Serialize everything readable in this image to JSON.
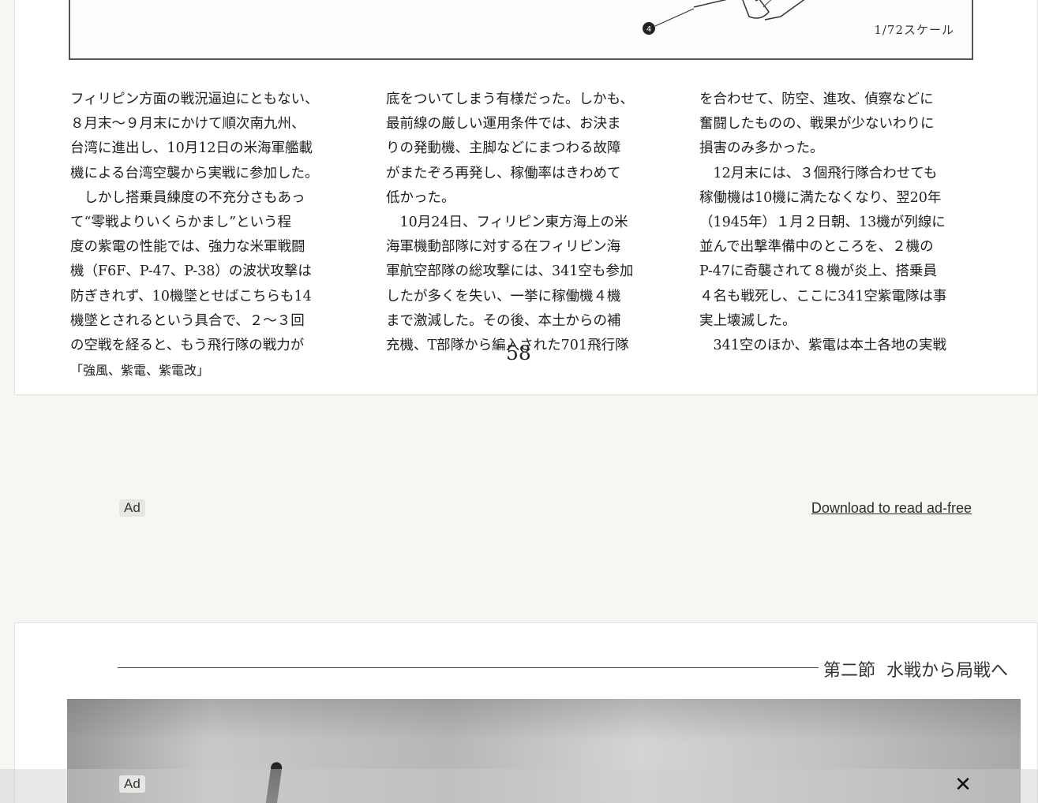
{
  "page_top": {
    "figure_scale_label": "1/72スケール",
    "figure_callout": "4",
    "columns": [
      [
        "フィリピン方面の戦況逼迫にともない、",
        "８月末～９月末にかけて順次南九州、",
        "台湾に進出し、10月12日の米海軍艦載",
        "機による台湾空襲から実戦に参加した。",
        "　しかし搭乗員練度の不充分さもあっ",
        "て“零戦よりいくらかまし”という程",
        "度の紫電の性能では、強力な米軍戦闘",
        "機（F6F、P-47、P-38）の波状攻撃は",
        "防ぎきれず、10機墜とせばこちらも14",
        "機墜とされるという具合で、２～３回",
        "の空戦を経ると、もう飛行隊の戦力が",
        "「強風、紫電、紫電改」"
      ],
      [
        "底をついてしまう有様だった。しかも、",
        "最前線の厳しい運用条件では、お決ま",
        "りの発動機、主脚などにまつわる故障",
        "がまたぞろ再発し、稼働率はきわめて",
        "低かった。",
        "　10月24日、フィリピン東方海上の米",
        "海軍機動部隊に対する在フィリピン海",
        "軍航空部隊の総攻撃には、341空も参加",
        "したが多くを失い、一挙に稼働機４機",
        "まで激減した。その後、本土からの補",
        "充機、T部隊から編入された701飛行隊"
      ],
      [
        "を合わせて、防空、進攻、偵察などに",
        "奮闘したものの、戦果が少ないわりに",
        "損害のみ多かった。",
        "　12月末には、３個飛行隊合わせても",
        "稼働機は10機に満たなくなり、翌20年",
        "（1945年）１月２日朝、13機が列線に",
        "並んで出撃準備中のところを、２機の",
        "P-47に奇襲されて８機が炎上、搭乗員",
        "４名も戦死し、ここに341空紫電隊は事",
        "実上壊滅した。",
        "　341空のほか、紫電は本土各地の実戦"
      ]
    ],
    "page_number": "58"
  },
  "ad_slot": {
    "badge": "Ad",
    "ad_free_link": "Download to read ad-free"
  },
  "page_bottom": {
    "section_label": "第二節",
    "section_title": "水戦から局戦へ"
  },
  "sticky_ad": {
    "badge": "Ad",
    "close_label": "✕"
  },
  "colors": {
    "background": "#f7f6f2",
    "page": "#ffffff",
    "text": "#1e1e1e"
  }
}
